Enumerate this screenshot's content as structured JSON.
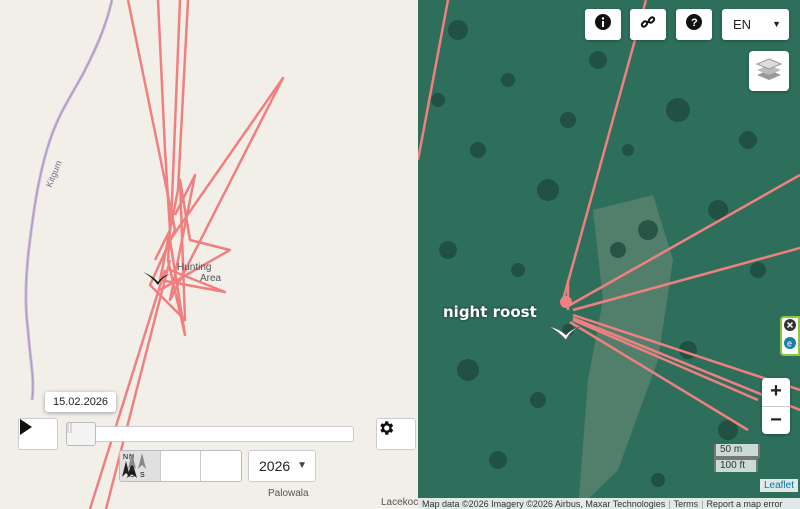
{
  "left_map": {
    "places": {
      "hunting_area": "Hunting",
      "area_suffix": "Area",
      "road": "Kitgum",
      "town1": "Palowala",
      "town2": "Lacekoco"
    },
    "date_tooltip": "15.02.2026",
    "controls": {
      "play_icon": "play-icon",
      "settings_icon": "gear-icon",
      "north_options": [
        {
          "letters": [
            "N",
            ""
          ],
          "icon": "north-up-icon",
          "active": true
        },
        {
          "letters": [
            "",
            "S"
          ],
          "icon": "heading-up-icon",
          "active": false
        },
        {
          "letters": [
            "N",
            "S"
          ],
          "icon": "split-north-icon",
          "active": false
        }
      ],
      "year_value": "2026"
    },
    "track_color": "#f08080"
  },
  "right_map": {
    "toolbar": {
      "info_icon": "info-icon",
      "link_icon": "link-icon",
      "help_icon": "help-icon",
      "language": "EN"
    },
    "layers_icon": "layers-icon",
    "label_night_roost": "night roost",
    "zoom_in": "+",
    "zoom_out": "−",
    "scale": {
      "metric": "50 m",
      "imperial": "100 ft"
    },
    "leaflet": "Leaflet",
    "attribution": {
      "text": "Map data ©2026 Imagery ©2026 Airbus, Maxar Technologies",
      "terms": "Terms",
      "report": "Report a map error"
    },
    "side_widget": {
      "close_icon": "close-circle-icon",
      "e_icon": "e-badge-icon"
    }
  }
}
